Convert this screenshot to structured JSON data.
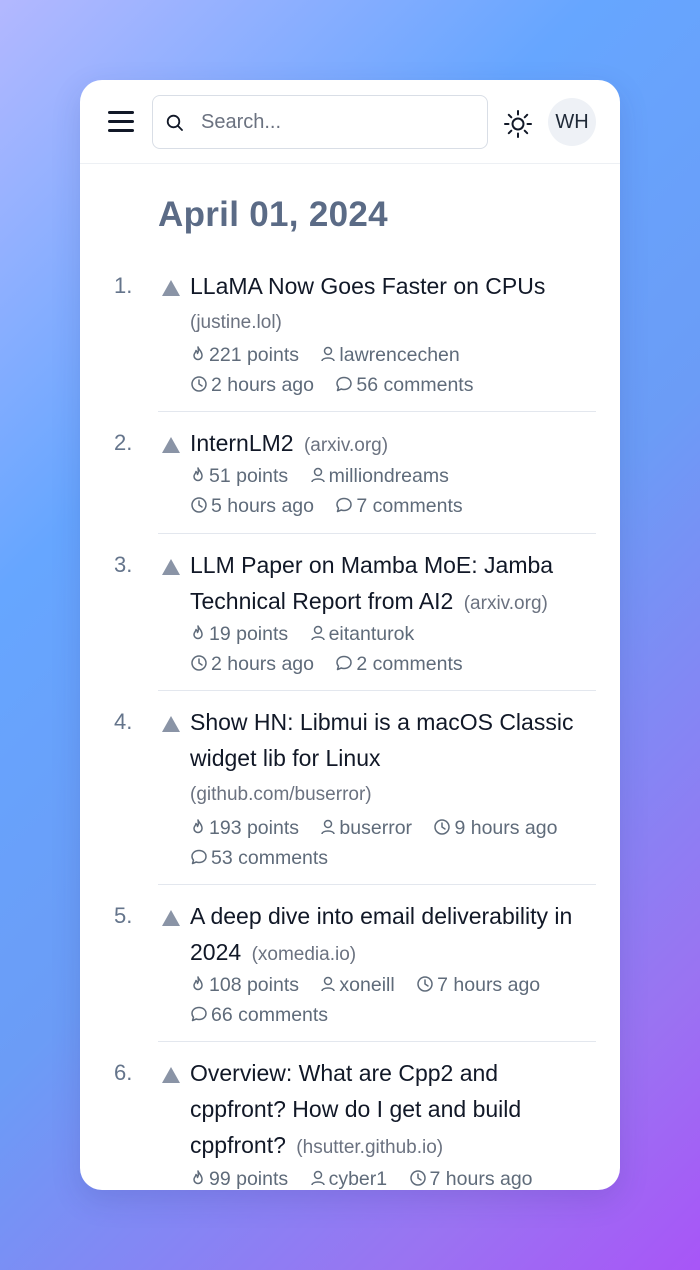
{
  "header": {
    "search_placeholder": "Search...",
    "avatar_initials": "WH"
  },
  "date_heading": "April 01, 2024",
  "stories": [
    {
      "rank": "1.",
      "title": "LLaMA Now Goes Faster on CPUs",
      "domain": "(justine.lol)",
      "points": "221 points",
      "user": "lawrencechen",
      "time": "2 hours ago",
      "comments": "56 comments"
    },
    {
      "rank": "2.",
      "title": "InternLM2",
      "domain": "(arxiv.org)",
      "points": "51 points",
      "user": "milliondreams",
      "time": "5 hours ago",
      "comments": "7 comments"
    },
    {
      "rank": "3.",
      "title": "LLM Paper on Mamba MoE: Jamba Technical Report from AI2",
      "domain": "(arxiv.org)",
      "points": "19 points",
      "user": "eitanturok",
      "time": "2 hours ago",
      "comments": "2 comments"
    },
    {
      "rank": "4.",
      "title": "Show HN: Libmui is a macOS Classic widget lib for Linux",
      "domain": "(github.com/buserror)",
      "points": "193 points",
      "user": "buserror",
      "time": "9 hours ago",
      "comments": "53 comments"
    },
    {
      "rank": "5.",
      "title": "A deep dive into email deliverability in 2024",
      "domain": "(xomedia.io)",
      "points": "108 points",
      "user": "xoneill",
      "time": "7 hours ago",
      "comments": "66 comments"
    },
    {
      "rank": "6.",
      "title": "Overview: What are Cpp2 and cppfront? How do I get and build cppfront?",
      "domain": "(hsutter.github.io)",
      "points": "99 points",
      "user": "cyber1",
      "time": "7 hours ago",
      "comments": ""
    }
  ],
  "colors": {
    "accent": "#5b6b86",
    "upvote": "#8a94a6",
    "text": "#111827",
    "muted": "#6b7280"
  }
}
